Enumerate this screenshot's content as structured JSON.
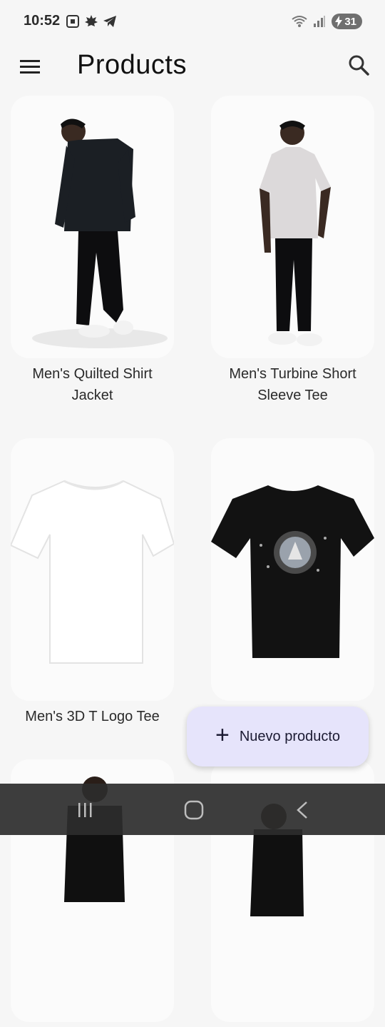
{
  "status": {
    "time": "10:52",
    "battery": "31",
    "icons": [
      "screenshot-icon",
      "maple-icon",
      "telegram-icon",
      "wifi-icon",
      "signal-icon",
      "battery-charging-icon"
    ]
  },
  "app_bar": {
    "title": "Products",
    "menu_icon": "menu-icon",
    "search_icon": "search-icon"
  },
  "products": [
    {
      "name": "Men's Quilted Shirt Jacket"
    },
    {
      "name": "Men's Turbine Short Sleeve Tee"
    },
    {
      "name": "Men's 3D T Logo Tee"
    },
    {
      "name": ""
    },
    {
      "name": ""
    },
    {
      "name": ""
    }
  ],
  "fab": {
    "label": "Nuevo producto",
    "icon": "plus-icon"
  },
  "nav": {
    "icons": [
      "recent-apps-icon",
      "home-icon",
      "back-icon"
    ]
  },
  "colors": {
    "background": "#f6f6f6",
    "fab": "#e6e4fb",
    "nav": "#2c2c2c"
  }
}
